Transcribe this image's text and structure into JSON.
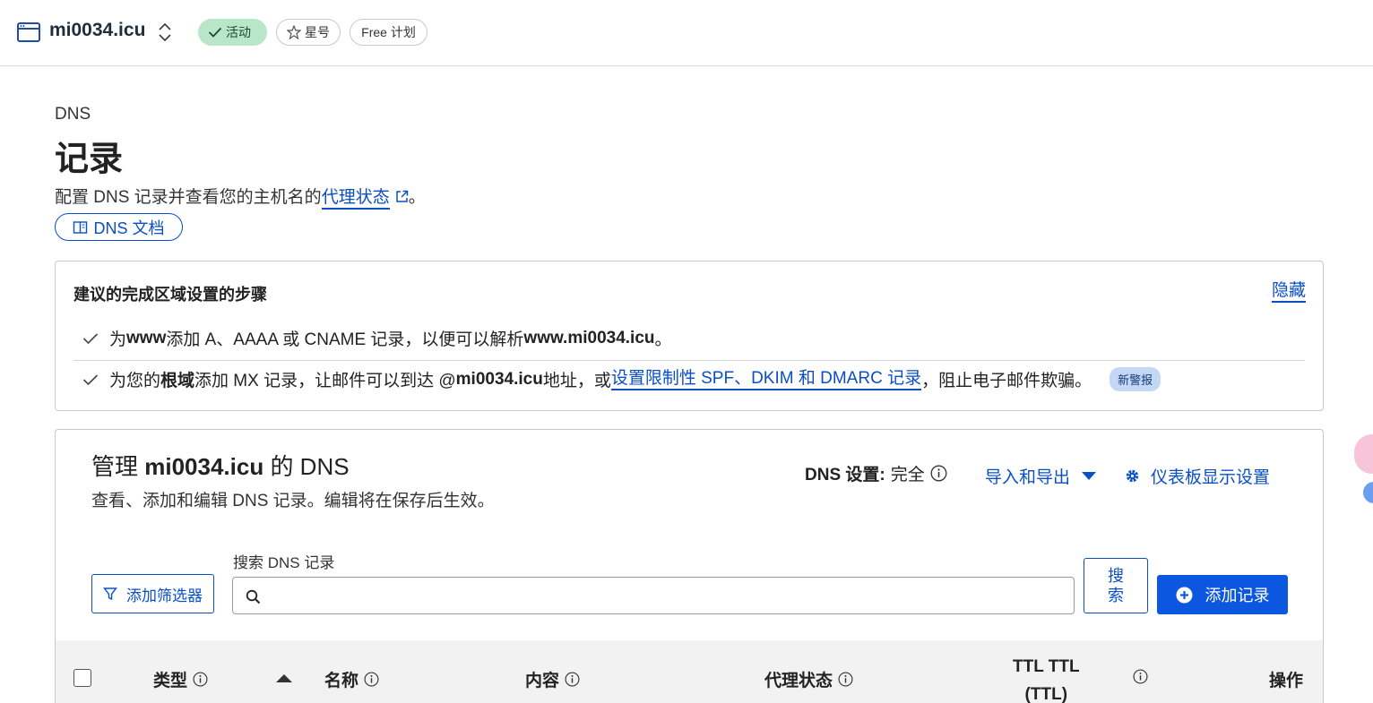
{
  "topbar": {
    "zone_name": "mi0034.icu",
    "status_label": "活动",
    "star_label": "星号",
    "plan_label": "Free 计划"
  },
  "header": {
    "eyebrow": "DNS",
    "title": "记录",
    "desc_prefix": "配置 DNS 记录并查看您的主机名的",
    "desc_link": "代理状态",
    "desc_suffix": "。",
    "doc_button": "DNS 文档"
  },
  "steps": {
    "title": "建议的完成区域设置的步骤",
    "hide_label": "隐藏",
    "step1": {
      "t1": "为 ",
      "b1": "www",
      "t2": " 添加 A、AAAA 或 CNAME 记录，以便可以解析 ",
      "b2": "www.mi0034.icu",
      "t3": "。"
    },
    "step2": {
      "t1": "为您的",
      "b1": "根域",
      "t2": "添加 MX 记录，让邮件可以到达 @",
      "b2": "mi0034.icu",
      "t3": " 地址，或",
      "link": "设置限制性 SPF、DKIM 和 DMARC 记录",
      "t4": "，阻止电子邮件欺骗。",
      "badge": "新警报"
    }
  },
  "manage": {
    "title_prefix": "管理 ",
    "title_zone": "mi0034.icu",
    "title_suffix": " 的 DNS",
    "desc": "查看、添加和编辑 DNS 记录。编辑将在保存后生效。",
    "dns_setting_label": "DNS 设置:",
    "dns_setting_value": "完全",
    "import_export": "导入和导出",
    "dashboard_settings": "仪表板显示设置",
    "search_label": "搜索 DNS 记录",
    "search_value": "",
    "filter_button": "添加筛选器",
    "search_button": "搜索",
    "add_button": "添加记录"
  },
  "table": {
    "col_type": "类型",
    "col_name": "名称",
    "col_content": "内容",
    "col_proxy": "代理状态",
    "col_ttl_line1": "TTL  TTL",
    "col_ttl_line2": "(TTL)",
    "col_actions": "操作"
  },
  "colors": {
    "accent": "#0b57e0",
    "link": "#0b4fc6",
    "active_pill": "#b9e5c9",
    "badge": "#c4d8f6"
  }
}
